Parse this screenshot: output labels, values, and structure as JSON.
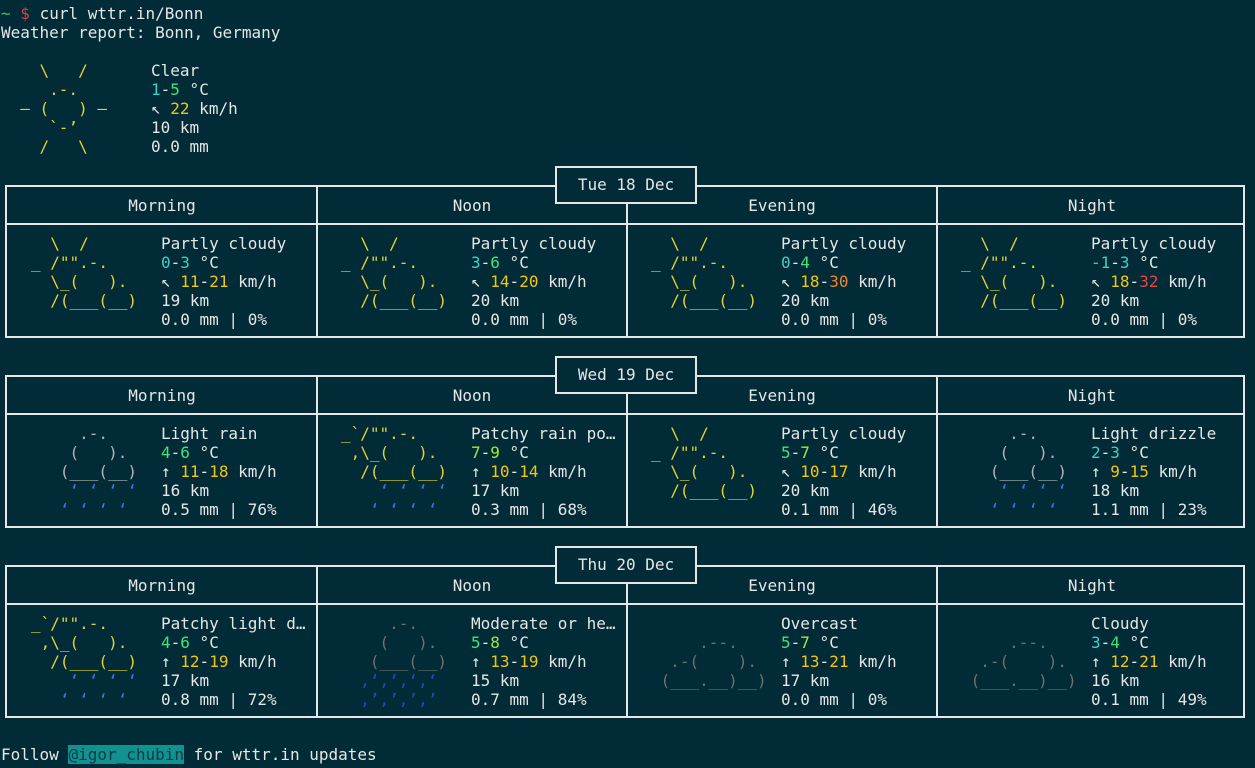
{
  "prompt": {
    "tilde": "~",
    "dollar": "$",
    "command": "curl wttr.in/Bonn"
  },
  "report_title": "Weather report: Bonn, Germany",
  "current": {
    "ascii": [
      "    \\   /",
      "     .-.",
      "  ― (   ) ―",
      "     `-’",
      "    /   \\"
    ],
    "condition": "Clear",
    "temp_lo": "1",
    "temp_hi": "5",
    "temp_unit": " °C",
    "wind_arrow": "↖",
    "wind": "22",
    "wind_unit": " km/h",
    "visibility": "10 km",
    "precip": "0.0 mm"
  },
  "period_labels": [
    "Morning",
    "Noon",
    "Evening",
    "Night"
  ],
  "days": [
    {
      "date": "Tue 18 Dec",
      "periods": [
        {
          "condition": "Partly cloudy",
          "temp": "0-3",
          "unit": " °C",
          "wind_arrow": "↖",
          "wind": "11-21",
          "wind_unit": " km/h",
          "visibility": "19 km",
          "precip": "0.0 mm | 0%",
          "ascii": [
            "  \\  /",
            "_ /\"\".-.",
            "  \\_(   ).",
            "  /(___(__)",
            ""
          ]
        },
        {
          "condition": "Partly cloudy",
          "temp": "3-6",
          "unit": " °C",
          "wind_arrow": "↖",
          "wind": "14-20",
          "wind_unit": " km/h",
          "visibility": "20 km",
          "precip": "0.0 mm | 0%",
          "ascii": [
            "  \\  /",
            "_ /\"\".-.",
            "  \\_(   ).",
            "  /(___(__)",
            ""
          ]
        },
        {
          "condition": "Partly cloudy",
          "temp": "0-4",
          "unit": " °C",
          "wind_arrow": "↖",
          "wind": "18-30",
          "wind_unit": " km/h",
          "visibility": "20 km",
          "precip": "0.0 mm | 0%",
          "ascii": [
            "  \\  /",
            "_ /\"\".-.",
            "  \\_(   ).",
            "  /(___(__)",
            ""
          ]
        },
        {
          "condition": "Partly cloudy",
          "temp": "-1-3",
          "unit": " °C",
          "wind_arrow": "↖",
          "wind": "18-32",
          "wind_unit": " km/h",
          "visibility": "20 km",
          "precip": "0.0 mm | 0%",
          "ascii": [
            "  \\  /",
            "_ /\"\".-.",
            "  \\_(   ).",
            "  /(___(__)",
            ""
          ]
        }
      ]
    },
    {
      "date": "Wed 19 Dec",
      "periods": [
        {
          "condition": "Light rain",
          "temp": "4-6",
          "unit": " °C",
          "wind_arrow": "↑",
          "wind": "11-18",
          "wind_unit": " km/h",
          "visibility": "16 km",
          "precip": "0.5 mm | 76%",
          "ascii": [
            "     .-.",
            "    (   ).",
            "   (___(__)",
            "    ‘ ‘ ‘ ‘",
            "   ‘ ‘ ‘ ‘"
          ]
        },
        {
          "condition": "Patchy rain po…",
          "temp": "7-9",
          "unit": " °C",
          "wind_arrow": "↑",
          "wind": "10-14",
          "wind_unit": " km/h",
          "visibility": "17 km",
          "precip": "0.3 mm | 68%",
          "ascii": [
            "_`/\"\".-.",
            " ,\\_(   ).",
            "  /(___(__)",
            "    ‘ ‘ ‘ ‘",
            "   ‘ ‘ ‘ ‘"
          ]
        },
        {
          "condition": "Partly cloudy",
          "temp": "5-7",
          "unit": " °C",
          "wind_arrow": "↖",
          "wind": "10-17",
          "wind_unit": " km/h",
          "visibility": "20 km",
          "precip": "0.1 mm | 46%",
          "ascii": [
            "  \\  /",
            "_ /\"\".-.",
            "  \\_(   ).",
            "  /(___(__)",
            ""
          ]
        },
        {
          "condition": "Light drizzle",
          "temp": "2-3",
          "unit": " °C",
          "wind_arrow": "↑",
          "wind": "9-15",
          "wind_unit": " km/h",
          "visibility": "18 km",
          "precip": "1.1 mm | 23%",
          "ascii": [
            "     .-.",
            "    (   ).",
            "   (___(__)",
            "    ‘ ‘ ‘ ‘",
            "   ‘ ‘ ‘ ‘"
          ]
        }
      ]
    },
    {
      "date": "Thu 20 Dec",
      "periods": [
        {
          "condition": "Patchy light d…",
          "temp": "4-6",
          "unit": " °C",
          "wind_arrow": "↑",
          "wind": "12-19",
          "wind_unit": " km/h",
          "visibility": "17 km",
          "precip": "0.8 mm | 72%",
          "ascii": [
            "_`/\"\".-.",
            " ,\\_(   ).",
            "  /(___(__)",
            "    ‘ ‘ ‘ ‘",
            "   ‘ ‘ ‘ ‘"
          ]
        },
        {
          "condition": "Moderate or he…",
          "temp": "5-8",
          "unit": " °C",
          "wind_arrow": "↑",
          "wind": "13-19",
          "wind_unit": " km/h",
          "visibility": "15 km",
          "precip": "0.7 mm | 84%",
          "ascii": [
            "     .-.",
            "    (   ).",
            "   (___(__)",
            "  ‚‘‚‘‚‘‚‘",
            "  ‚’‚’‚’‚’"
          ]
        },
        {
          "condition": "Overcast",
          "temp": "5-7",
          "unit": " °C",
          "wind_arrow": "↑",
          "wind": "13-21",
          "wind_unit": " km/h",
          "visibility": "17 km",
          "precip": "0.0 mm | 0%",
          "ascii": [
            "",
            "     .--.",
            "  .-(    ).",
            " (___.__)__)",
            ""
          ]
        },
        {
          "condition": "Cloudy",
          "temp": "3-4",
          "unit": " °C",
          "wind_arrow": "↑",
          "wind": "12-21",
          "wind_unit": " km/h",
          "visibility": "16 km",
          "precip": "0.1 mm | 49%",
          "ascii": [
            "",
            "     .--.",
            "  .-(    ).",
            " (___.__)__)",
            ""
          ]
        }
      ]
    }
  ],
  "footer": {
    "follow": "Follow ",
    "handle": "@igor_chubin",
    "rest": " for wttr.in updates"
  }
}
